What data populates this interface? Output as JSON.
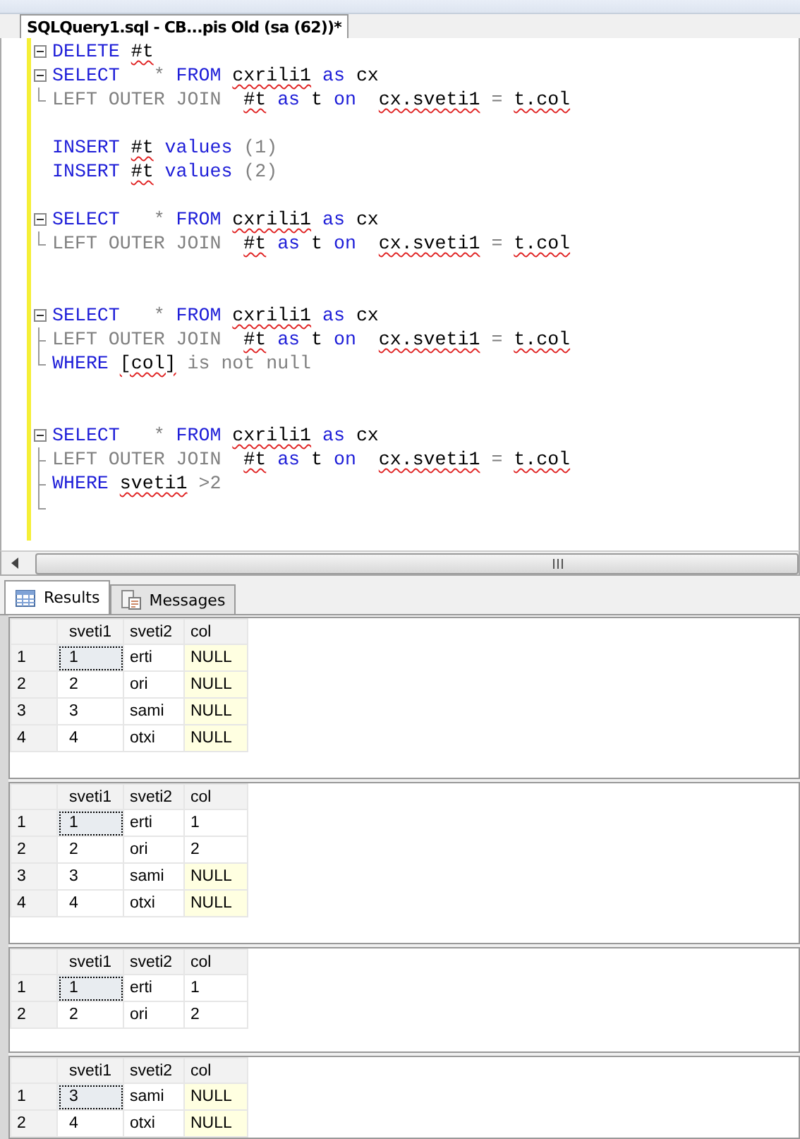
{
  "document_tab": {
    "title": "SQLQuery1.sql - CB...pis Old (sa (62))*",
    "selected": true
  },
  "editor": {
    "lines": [
      {
        "kind": "block-start",
        "tokens": [
          {
            "kind": "keyword",
            "text": "DELETE"
          },
          {
            "kind": "flagged",
            "text": "#t"
          }
        ]
      },
      {
        "kind": "block-start",
        "tokens": [
          {
            "kind": "keyword",
            "text": "SELECT"
          },
          {
            "kind": "gray",
            "text": "  *"
          },
          {
            "kind": "keyword",
            "text": "FROM"
          },
          {
            "kind": "flagged",
            "text": "cxrili1"
          },
          {
            "kind": "keyword",
            "text": "as"
          },
          {
            "kind": "plain",
            "text": "cx"
          }
        ]
      },
      {
        "kind": "block-end",
        "tokens": [
          {
            "kind": "gray",
            "text": "LEFT OUTER JOIN "
          },
          {
            "kind": "flagged",
            "text": "#t"
          },
          {
            "kind": "keyword",
            "text": "as"
          },
          {
            "kind": "plain",
            "text": "t"
          },
          {
            "kind": "keyword",
            "text": "on "
          },
          {
            "kind": "flagged",
            "text": "cx.sveti1"
          },
          {
            "kind": "gray",
            "text": "="
          },
          {
            "kind": "flagged",
            "text": "t.col"
          }
        ]
      },
      {
        "kind": "plain"
      },
      {
        "kind": "plain",
        "tokens": [
          {
            "kind": "keyword",
            "text": "INSERT"
          },
          {
            "kind": "flagged",
            "text": "#t"
          },
          {
            "kind": "keyword",
            "text": "values"
          },
          {
            "kind": "gray",
            "text": "(1)"
          }
        ]
      },
      {
        "kind": "plain",
        "tokens": [
          {
            "kind": "keyword",
            "text": "INSERT"
          },
          {
            "kind": "flagged",
            "text": "#t"
          },
          {
            "kind": "keyword",
            "text": "values"
          },
          {
            "kind": "gray",
            "text": "(2)"
          }
        ]
      },
      {
        "kind": "plain"
      },
      {
        "kind": "block-start",
        "tokens": [
          {
            "kind": "keyword",
            "text": "SELECT"
          },
          {
            "kind": "gray",
            "text": "  *"
          },
          {
            "kind": "keyword",
            "text": "FROM"
          },
          {
            "kind": "flagged",
            "text": "cxrili1"
          },
          {
            "kind": "keyword",
            "text": "as"
          },
          {
            "kind": "plain",
            "text": "cx"
          }
        ]
      },
      {
        "kind": "block-end",
        "tokens": [
          {
            "kind": "gray",
            "text": "LEFT OUTER JOIN "
          },
          {
            "kind": "flagged",
            "text": "#t"
          },
          {
            "kind": "keyword",
            "text": "as"
          },
          {
            "kind": "plain",
            "text": "t"
          },
          {
            "kind": "keyword",
            "text": "on "
          },
          {
            "kind": "flagged",
            "text": "cx.sveti1"
          },
          {
            "kind": "gray",
            "text": "="
          },
          {
            "kind": "flagged",
            "text": "t.col"
          }
        ]
      },
      {
        "kind": "plain"
      },
      {
        "kind": "plain"
      },
      {
        "kind": "block-start",
        "tokens": [
          {
            "kind": "keyword",
            "text": "SELECT"
          },
          {
            "kind": "gray",
            "text": "  *"
          },
          {
            "kind": "keyword",
            "text": "FROM"
          },
          {
            "kind": "flagged",
            "text": "cxrili1"
          },
          {
            "kind": "keyword",
            "text": "as"
          },
          {
            "kind": "plain",
            "text": "cx"
          }
        ]
      },
      {
        "kind": "block-inner",
        "tokens": [
          {
            "kind": "gray",
            "text": "LEFT OUTER JOIN "
          },
          {
            "kind": "flagged",
            "text": "#t"
          },
          {
            "kind": "keyword",
            "text": "as"
          },
          {
            "kind": "plain",
            "text": "t"
          },
          {
            "kind": "keyword",
            "text": "on "
          },
          {
            "kind": "flagged",
            "text": "cx.sveti1"
          },
          {
            "kind": "gray",
            "text": "="
          },
          {
            "kind": "flagged",
            "text": "t.col"
          }
        ]
      },
      {
        "kind": "block-end",
        "tokens": [
          {
            "kind": "keyword",
            "text": "WHERE"
          },
          {
            "kind": "flagged",
            "text": "[col]"
          },
          {
            "kind": "gray",
            "text": "is not null"
          }
        ]
      },
      {
        "kind": "plain"
      },
      {
        "kind": "plain"
      },
      {
        "kind": "block-start",
        "tokens": [
          {
            "kind": "keyword",
            "text": "SELECT"
          },
          {
            "kind": "gray",
            "text": "  *"
          },
          {
            "kind": "keyword",
            "text": "FROM"
          },
          {
            "kind": "flagged",
            "text": "cxrili1"
          },
          {
            "kind": "keyword",
            "text": "as"
          },
          {
            "kind": "plain",
            "text": "cx"
          }
        ]
      },
      {
        "kind": "block-inner",
        "tokens": [
          {
            "kind": "gray",
            "text": "LEFT OUTER JOIN "
          },
          {
            "kind": "flagged",
            "text": "#t"
          },
          {
            "kind": "keyword",
            "text": "as"
          },
          {
            "kind": "plain",
            "text": "t"
          },
          {
            "kind": "keyword",
            "text": "on "
          },
          {
            "kind": "flagged",
            "text": "cx.sveti1"
          },
          {
            "kind": "gray",
            "text": "="
          },
          {
            "kind": "flagged",
            "text": "t.col"
          }
        ]
      },
      {
        "kind": "block-inner",
        "tokens": [
          {
            "kind": "keyword",
            "text": "WHERE"
          },
          {
            "kind": "flagged",
            "text": "sveti1"
          },
          {
            "kind": "gray",
            "text": ">2"
          }
        ]
      },
      {
        "kind": "block-end"
      }
    ]
  },
  "result_tabs": [
    {
      "label": "Results",
      "selected": true
    },
    {
      "label": "Messages",
      "selected": false
    }
  ],
  "grids": [
    {
      "columns": [
        "sveti1",
        "sveti2",
        "col"
      ],
      "rows": [
        {
          "row_number": "1",
          "sveti1": "1",
          "sveti2": "erti",
          "col": "NULL",
          "col_is_null": true,
          "selected": true
        },
        {
          "row_number": "2",
          "sveti1": "2",
          "sveti2": "ori",
          "col": "NULL",
          "col_is_null": true,
          "selected": false
        },
        {
          "row_number": "3",
          "sveti1": "3",
          "sveti2": "sami",
          "col": "NULL",
          "col_is_null": true,
          "selected": false
        },
        {
          "row_number": "4",
          "sveti1": "4",
          "sveti2": "otxi",
          "col": "NULL",
          "col_is_null": true,
          "selected": false
        }
      ]
    },
    {
      "columns": [
        "sveti1",
        "sveti2",
        "col"
      ],
      "rows": [
        {
          "row_number": "1",
          "sveti1": "1",
          "sveti2": "erti",
          "col": "1",
          "col_is_null": false,
          "selected": true
        },
        {
          "row_number": "2",
          "sveti1": "2",
          "sveti2": "ori",
          "col": "2",
          "col_is_null": false,
          "selected": false
        },
        {
          "row_number": "3",
          "sveti1": "3",
          "sveti2": "sami",
          "col": "NULL",
          "col_is_null": true,
          "selected": false
        },
        {
          "row_number": "4",
          "sveti1": "4",
          "sveti2": "otxi",
          "col": "NULL",
          "col_is_null": true,
          "selected": false
        }
      ]
    },
    {
      "columns": [
        "sveti1",
        "sveti2",
        "col"
      ],
      "rows": [
        {
          "row_number": "1",
          "sveti1": "1",
          "sveti2": "erti",
          "col": "1",
          "col_is_null": false,
          "selected": true
        },
        {
          "row_number": "2",
          "sveti1": "2",
          "sveti2": "ori",
          "col": "2",
          "col_is_null": false,
          "selected": false
        }
      ]
    },
    {
      "columns": [
        "sveti1",
        "sveti2",
        "col"
      ],
      "rows": [
        {
          "row_number": "1",
          "sveti1": "3",
          "sveti2": "sami",
          "col": "NULL",
          "col_is_null": true,
          "selected": true
        },
        {
          "row_number": "2",
          "sveti1": "4",
          "sveti2": "otxi",
          "col": "NULL",
          "col_is_null": true,
          "selected": false
        }
      ]
    }
  ]
}
